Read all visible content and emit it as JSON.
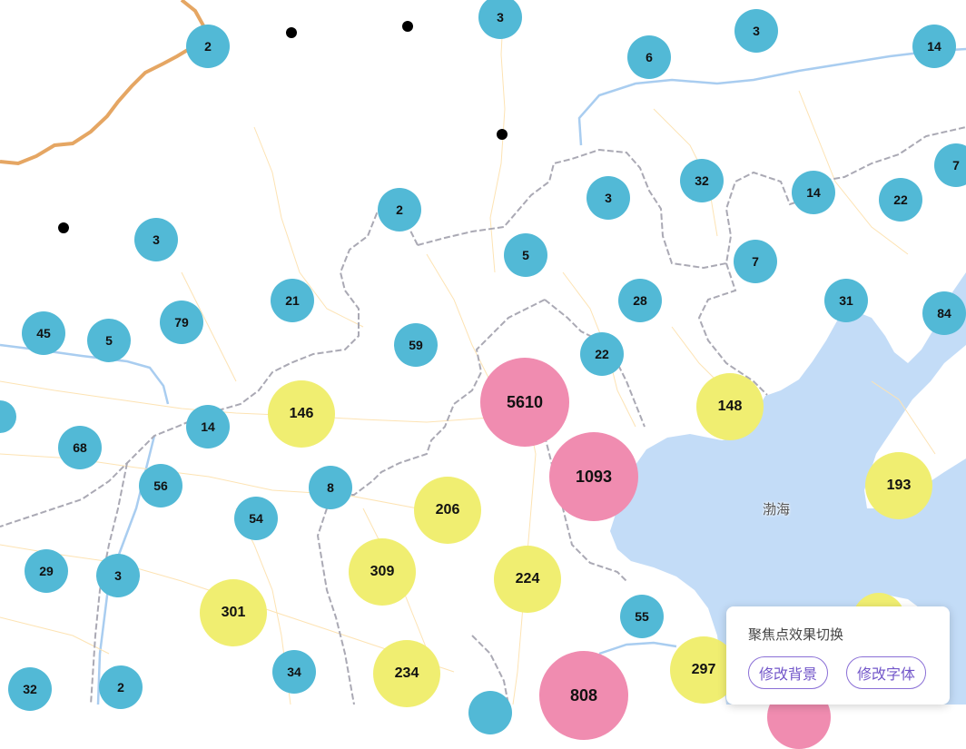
{
  "map": {
    "sea_label": "渤海",
    "colors": {
      "land": "#ffffff",
      "sea": "#c3dcf7",
      "river": "#a9cdf0",
      "road": "#fde3b3",
      "border": "#aaa9b4",
      "national_border": "#e5a663",
      "cluster_small": "#52b9d6",
      "cluster_medium": "#f0ee71",
      "cluster_large": "#f08cb0"
    },
    "clusters": [
      {
        "id": "c1",
        "count": "2",
        "tier": "blue"
      },
      {
        "id": "c2",
        "count": "3",
        "tier": "blue"
      },
      {
        "id": "c3",
        "count": "6",
        "tier": "blue"
      },
      {
        "id": "c4",
        "count": "3",
        "tier": "blue"
      },
      {
        "id": "c5",
        "count": "14",
        "tier": "blue"
      },
      {
        "id": "c6",
        "count": "3",
        "tier": "blue"
      },
      {
        "id": "c7",
        "count": "32",
        "tier": "blue"
      },
      {
        "id": "c8",
        "count": "14",
        "tier": "blue"
      },
      {
        "id": "c9",
        "count": "22",
        "tier": "blue"
      },
      {
        "id": "c10",
        "count": "7",
        "tier": "blue"
      },
      {
        "id": "c11",
        "count": "2",
        "tier": "blue"
      },
      {
        "id": "c12",
        "count": "3",
        "tier": "blue"
      },
      {
        "id": "c13",
        "count": "5",
        "tier": "blue"
      },
      {
        "id": "c14",
        "count": "7",
        "tier": "blue"
      },
      {
        "id": "c15",
        "count": "21",
        "tier": "blue"
      },
      {
        "id": "c16",
        "count": "79",
        "tier": "blue"
      },
      {
        "id": "c17",
        "count": "45",
        "tier": "blue"
      },
      {
        "id": "c18",
        "count": "5",
        "tier": "blue"
      },
      {
        "id": "c19",
        "count": "28",
        "tier": "blue"
      },
      {
        "id": "c20",
        "count": "31",
        "tier": "blue"
      },
      {
        "id": "c21",
        "count": "84",
        "tier": "blue"
      },
      {
        "id": "c22",
        "count": "59",
        "tier": "blue"
      },
      {
        "id": "c23",
        "count": "22",
        "tier": "blue"
      },
      {
        "id": "c24",
        "count": "5610",
        "tier": "pink"
      },
      {
        "id": "c25",
        "count": "146",
        "tier": "yellow"
      },
      {
        "id": "c26",
        "count": "148",
        "tier": "yellow"
      },
      {
        "id": "c27",
        "count": "14",
        "tier": "blue"
      },
      {
        "id": "c28",
        "count": "68",
        "tier": "blue"
      },
      {
        "id": "c29",
        "count": "1093",
        "tier": "pink"
      },
      {
        "id": "c30",
        "count": "193",
        "tier": "yellow"
      },
      {
        "id": "c31",
        "count": "56",
        "tier": "blue"
      },
      {
        "id": "c32",
        "count": "8",
        "tier": "blue"
      },
      {
        "id": "c33",
        "count": "206",
        "tier": "yellow"
      },
      {
        "id": "c34",
        "count": "54",
        "tier": "blue"
      },
      {
        "id": "c35",
        "count": "29",
        "tier": "blue"
      },
      {
        "id": "c36",
        "count": "3",
        "tier": "blue"
      },
      {
        "id": "c37",
        "count": "309",
        "tier": "yellow"
      },
      {
        "id": "c38",
        "count": "224",
        "tier": "yellow"
      },
      {
        "id": "c39",
        "count": "301",
        "tier": "yellow"
      },
      {
        "id": "c40",
        "count": "55",
        "tier": "blue"
      },
      {
        "id": "c41",
        "count": "34",
        "tier": "blue"
      },
      {
        "id": "c42",
        "count": "234",
        "tier": "yellow"
      },
      {
        "id": "c43",
        "count": "808",
        "tier": "pink"
      },
      {
        "id": "c44",
        "count": "297",
        "tier": "yellow"
      },
      {
        "id": "c45",
        "count": "32",
        "tier": "blue"
      },
      {
        "id": "c46",
        "count": "2",
        "tier": "blue"
      }
    ],
    "single_points": 5
  },
  "panel": {
    "title": "聚焦点效果切换",
    "btn_background": "修改背景",
    "btn_font": "修改字体"
  }
}
